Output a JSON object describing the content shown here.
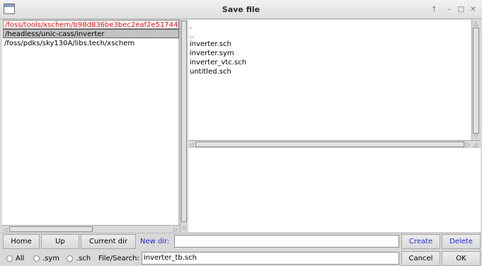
{
  "window": {
    "title": "Save file"
  },
  "titlebar_buttons": [
    "↑",
    "–",
    "□",
    "✕"
  ],
  "directories": [
    "/foss/tools/xschem/b98d836be3bec2eaf2e51744",
    "/headless/unic-cass/inverter",
    "/foss/pdks/sky130A/libs.tech/xschem"
  ],
  "dir_entries": [
    ".",
    ".."
  ],
  "files": [
    "inverter.sch",
    "inverter.sym",
    "inverter_vtc.sch",
    "untitled.sch"
  ],
  "buttons": {
    "home": "Home",
    "up": "Up",
    "current_dir": "Current dir",
    "create": "Create",
    "delete": "Delete",
    "cancel": "Cancel",
    "ok": "OK"
  },
  "new_dir": {
    "label": "New dir:",
    "value": ""
  },
  "filters": [
    {
      "label": "All"
    },
    {
      "label": ".sym"
    },
    {
      "label": ".sch"
    }
  ],
  "file_search": {
    "label": "File/Search:",
    "value": "inverter_tb.sch"
  },
  "colors": {
    "active_dir": "#e01010",
    "dir_entry": "#2323c8",
    "accent_button_text": "#1f2bd4"
  }
}
